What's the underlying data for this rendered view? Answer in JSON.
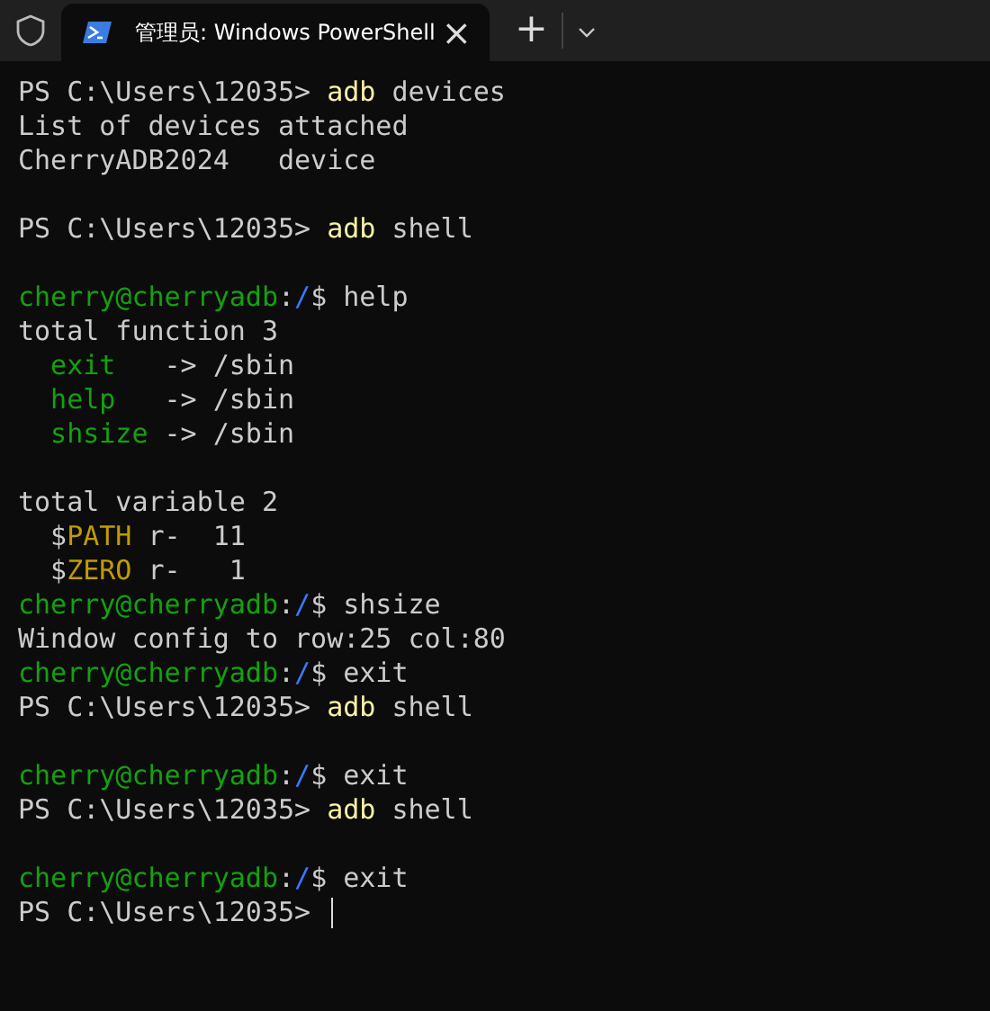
{
  "tab": {
    "title": "管理员: Windows PowerShell",
    "close": "×",
    "selected": true
  },
  "new_tab": "+",
  "lines": [
    {
      "kind": "text",
      "segments": [
        {
          "kind": "plain",
          "text": "PS C:\\Users\\12035> "
        },
        {
          "kind": "cmd",
          "text": "adb"
        },
        {
          "kind": "plain",
          "text": " devices"
        }
      ]
    },
    {
      "kind": "text",
      "segments": [
        {
          "kind": "plain",
          "text": "List of devices attached"
        }
      ]
    },
    {
      "kind": "text",
      "segments": [
        {
          "kind": "plain",
          "text": "CherryADB2024   device"
        }
      ]
    },
    {
      "kind": "blank"
    },
    {
      "kind": "text",
      "segments": [
        {
          "kind": "plain",
          "text": "PS C:\\Users\\12035> "
        },
        {
          "kind": "cmd",
          "text": "adb"
        },
        {
          "kind": "plain",
          "text": " shell"
        }
      ]
    },
    {
      "kind": "blank"
    },
    {
      "kind": "text",
      "segments": [
        {
          "kind": "user",
          "text": "cherry@cherryadb"
        },
        {
          "kind": "plain",
          "text": ":"
        },
        {
          "kind": "path",
          "text": "/"
        },
        {
          "kind": "plain",
          "text": "$ help"
        }
      ]
    },
    {
      "kind": "text",
      "segments": [
        {
          "kind": "plain",
          "text": "total function 3"
        }
      ]
    },
    {
      "kind": "text",
      "indent": true,
      "segments": [
        {
          "kind": "fn",
          "text": "exit"
        },
        {
          "kind": "plain",
          "text": "   -> /sbin"
        }
      ]
    },
    {
      "kind": "text",
      "indent": true,
      "segments": [
        {
          "kind": "fn",
          "text": "help"
        },
        {
          "kind": "plain",
          "text": "   -> /sbin"
        }
      ]
    },
    {
      "kind": "text",
      "indent": true,
      "segments": [
        {
          "kind": "fn",
          "text": "shsize"
        },
        {
          "kind": "plain",
          "text": " -> /sbin"
        }
      ]
    },
    {
      "kind": "blank"
    },
    {
      "kind": "text",
      "segments": [
        {
          "kind": "plain",
          "text": "total variable 2"
        }
      ]
    },
    {
      "kind": "text",
      "indent": true,
      "segments": [
        {
          "kind": "plain",
          "text": "$"
        },
        {
          "kind": "var",
          "text": "PATH"
        },
        {
          "kind": "plain",
          "text": " r-  11"
        }
      ]
    },
    {
      "kind": "text",
      "indent": true,
      "segments": [
        {
          "kind": "plain",
          "text": "$"
        },
        {
          "kind": "var",
          "text": "ZERO"
        },
        {
          "kind": "plain",
          "text": " r-   1"
        }
      ]
    },
    {
      "kind": "text",
      "segments": [
        {
          "kind": "user",
          "text": "cherry@cherryadb"
        },
        {
          "kind": "plain",
          "text": ":"
        },
        {
          "kind": "path",
          "text": "/"
        },
        {
          "kind": "plain",
          "text": "$ shsize"
        }
      ]
    },
    {
      "kind": "text",
      "segments": [
        {
          "kind": "plain",
          "text": "Window config to row:25 col:80"
        }
      ]
    },
    {
      "kind": "text",
      "segments": [
        {
          "kind": "user",
          "text": "cherry@cherryadb"
        },
        {
          "kind": "plain",
          "text": ":"
        },
        {
          "kind": "path",
          "text": "/"
        },
        {
          "kind": "plain",
          "text": "$ exit"
        }
      ]
    },
    {
      "kind": "text",
      "segments": [
        {
          "kind": "plain",
          "text": "PS C:\\Users\\12035> "
        },
        {
          "kind": "cmd",
          "text": "adb"
        },
        {
          "kind": "plain",
          "text": " shell"
        }
      ]
    },
    {
      "kind": "blank"
    },
    {
      "kind": "text",
      "segments": [
        {
          "kind": "user",
          "text": "cherry@cherryadb"
        },
        {
          "kind": "plain",
          "text": ":"
        },
        {
          "kind": "path",
          "text": "/"
        },
        {
          "kind": "plain",
          "text": "$ exit"
        }
      ]
    },
    {
      "kind": "text",
      "segments": [
        {
          "kind": "plain",
          "text": "PS C:\\Users\\12035> "
        },
        {
          "kind": "cmd",
          "text": "adb"
        },
        {
          "kind": "plain",
          "text": " shell"
        }
      ]
    },
    {
      "kind": "blank"
    },
    {
      "kind": "text",
      "segments": [
        {
          "kind": "user",
          "text": "cherry@cherryadb"
        },
        {
          "kind": "plain",
          "text": ":"
        },
        {
          "kind": "path",
          "text": "/"
        },
        {
          "kind": "plain",
          "text": "$ exit"
        }
      ]
    },
    {
      "kind": "prompt",
      "segments": [
        {
          "kind": "plain",
          "text": "PS C:\\Users\\12035> "
        }
      ]
    }
  ]
}
